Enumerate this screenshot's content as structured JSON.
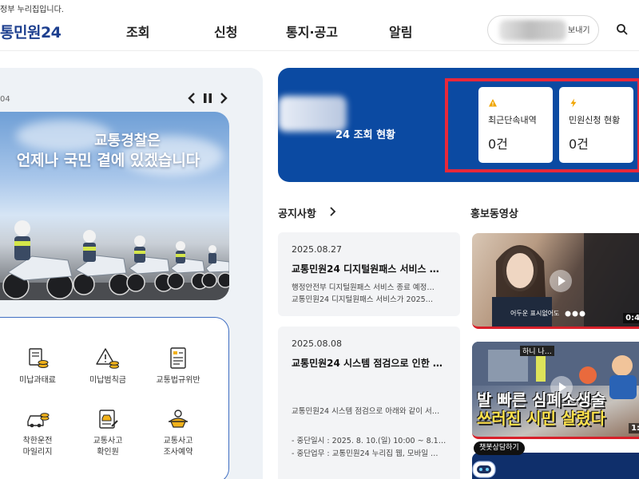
{
  "header": {
    "gov_notice": "정부 누리집입니다.",
    "logo_text": "통민원24",
    "nav": [
      "조회",
      "신청",
      "통지·공고",
      "알림"
    ],
    "user_pill_text": "보내기",
    "search_icon": "search-icon"
  },
  "banner": {
    "slide_counter": "04",
    "title_line1": "교통경찰은",
    "title_line2": "언제나 국민 곁에 있겠습니다",
    "controls": [
      "chevron-left-icon",
      "pause-icon",
      "chevron-right-icon"
    ]
  },
  "quick_menu": [
    {
      "label": "미납과태료",
      "icon": "fine-receipt-icon"
    },
    {
      "label": "미납범칙금",
      "icon": "warning-coins-icon"
    },
    {
      "label": "교통법규위반",
      "icon": "violation-document-icon"
    },
    {
      "label": "착한운전\n마일리지",
      "icon": "car-coins-icon"
    },
    {
      "label": "교통사고\n확인원",
      "icon": "accident-certificate-icon"
    },
    {
      "label": "교통사고\n조사예약",
      "icon": "accident-reservation-icon"
    }
  ],
  "status": {
    "title": "24 조회 현황",
    "cards": [
      {
        "label": "최근단속내역",
        "value": "0건",
        "icon": "warning-icon",
        "icon_color": "#f0a500"
      },
      {
        "label": "민원신청 현황",
        "value": "0건",
        "icon": "lightning-icon",
        "icon_color": "#f0a500"
      }
    ],
    "colors": {
      "box": "#0b4aa2",
      "highlight": "#e8283a"
    }
  },
  "notices": {
    "title": "공지사항",
    "items": [
      {
        "date": "2025.08.27",
        "headline": "교통민원24 디지털원패스 서비스 …",
        "lines": [
          "행정안전부 디지털원패스 서비스 종료 예정…",
          "교통민원24 디지털원패스 서비스가 2025…"
        ]
      },
      {
        "date": "2025.08.08",
        "headline": "교통민원24 시스템 점검으로 인한 …",
        "lines": [
          "교통민원24 시스템 점검으로 아래와 같이 서…",
          "- 중단일시 : 2025. 8. 10.(일) 10:00 ~ 8.1…",
          "- 중단업무 : 교통민원24 누리집 웹, 모바일 …"
        ]
      }
    ]
  },
  "videos": {
    "title": "홍보동영상",
    "items": [
      {
        "caption": "어두운 표시없어도",
        "duration": "0:43"
      },
      {
        "tag": "하니 나…",
        "headline_line1": "발 빠른 심폐소생술",
        "headline_line2": "쓰러진 시민 살렸다",
        "duration": "1:1"
      }
    ],
    "chatbot_label": "챗봇상담하기"
  }
}
